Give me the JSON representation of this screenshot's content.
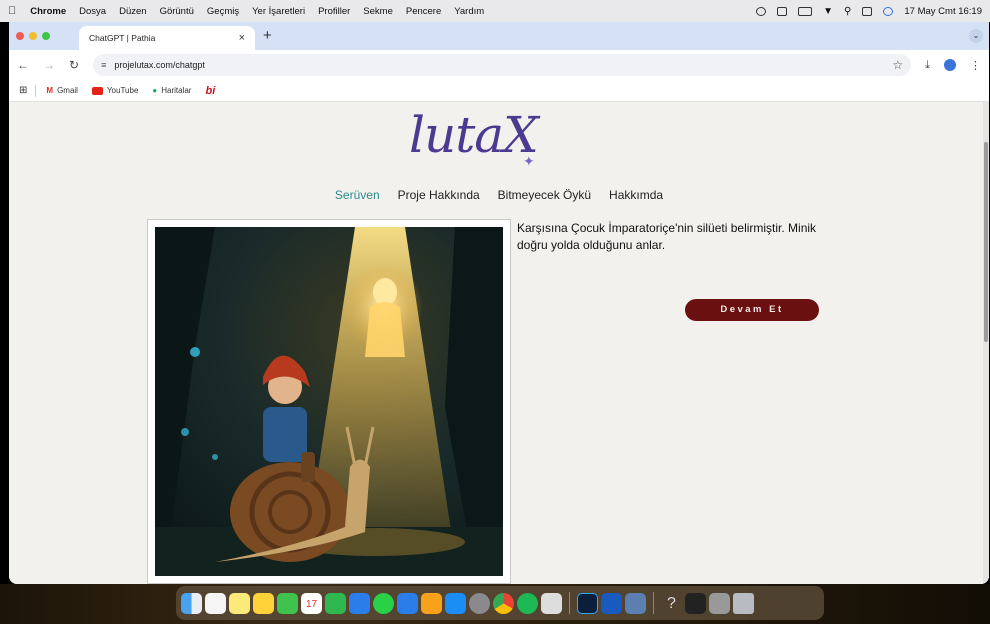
{
  "menubar": {
    "app": "Chrome",
    "items": [
      "Dosya",
      "Düzen",
      "Görüntü",
      "Geçmiş",
      "Yer İşaretleri",
      "Profiller",
      "Sekme",
      "Pencere",
      "Yardım"
    ],
    "clock": "17 May Cmt  16:19"
  },
  "browser": {
    "tab_title": "ChatGPT | Pathia",
    "url": "projelutax.com/chatgpt",
    "bookmarks": [
      "Gmail",
      "YouTube",
      "Haritalar",
      "bi"
    ]
  },
  "page": {
    "logo": "lutaX",
    "nav": [
      "Serüven",
      "Proje Hakkında",
      "Bitmeyecek Öykü",
      "Hakkımda"
    ],
    "story_text": "Karşısına Çocuk İmparatoriçe'nin silüeti belirmiştir. Minik doğru yolda olduğunu anlar.",
    "continue_button": "Devam Et"
  },
  "colors": {
    "accent_nav": "#2a8a8c",
    "button_bg": "#6b1010",
    "logo": "#4b3a8f"
  },
  "dock_apps": [
    "finder-icon",
    "launchpad-icon",
    "notes-icon",
    "stickies-icon",
    "facetime-icon",
    "calendar-icon",
    "numbers-icon",
    "keynote-icon",
    "whatsapp-icon",
    "minus-icon",
    "pages-icon",
    "appstore-icon",
    "settings-icon",
    "chrome-icon",
    "spotify-icon",
    "iphone-mirror-icon",
    "photoshop-icon",
    "word-icon",
    "preview-icon",
    "help-icon",
    "stocks-icon",
    "screenshot-icon",
    "trash-icon"
  ]
}
